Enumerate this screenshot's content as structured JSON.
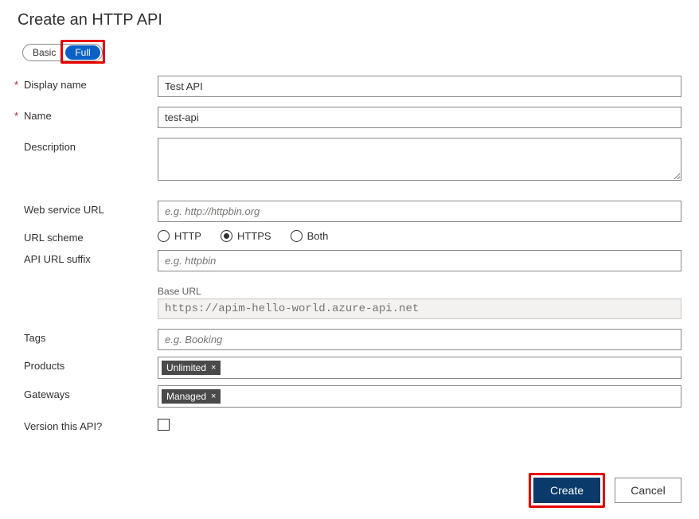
{
  "title": "Create an HTTP API",
  "toggle": {
    "basic": "Basic",
    "full": "Full",
    "active": "full"
  },
  "labels": {
    "displayName": "Display name",
    "name": "Name",
    "description": "Description",
    "webServiceUrl": "Web service URL",
    "urlScheme": "URL scheme",
    "apiUrlSuffix": "API URL suffix",
    "baseUrl": "Base URL",
    "tags": "Tags",
    "products": "Products",
    "gateways": "Gateways",
    "versionThisApi": "Version this API?"
  },
  "values": {
    "displayName": "Test API",
    "name": "test-api",
    "description": "",
    "webServiceUrl": "",
    "apiUrlSuffix": "",
    "baseUrl": "https://apim-hello-world.azure-api.net",
    "tags": "",
    "productsChip": "Unlimited",
    "gatewaysChip": "Managed",
    "versionChecked": false
  },
  "placeholders": {
    "webServiceUrl": "e.g. http://httpbin.org",
    "apiUrlSuffix": "e.g. httpbin",
    "tags": "e.g. Booking"
  },
  "urlScheme": {
    "http": "HTTP",
    "https": "HTTPS",
    "both": "Both",
    "selected": "https"
  },
  "chipClose": "×",
  "buttons": {
    "create": "Create",
    "cancel": "Cancel"
  },
  "requiredMark": "*"
}
